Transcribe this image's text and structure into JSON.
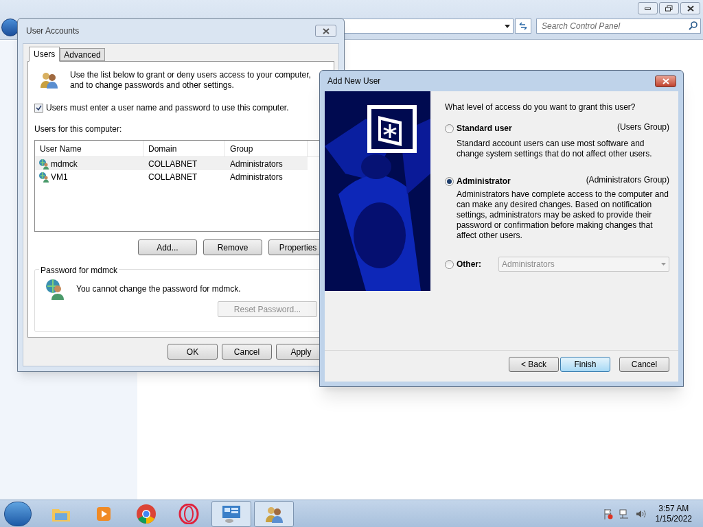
{
  "control_panel": {
    "search_placeholder": "Search Control Panel"
  },
  "user_accounts": {
    "title": "User Accounts",
    "tabs": [
      {
        "label": "Users",
        "selected": true
      },
      {
        "label": "Advanced",
        "selected": false
      }
    ],
    "intro": "Use the list below to grant or deny users access to your computer, and to change passwords and other settings.",
    "require_login": {
      "label": "Users must enter a user name and password to use this computer.",
      "checked": true
    },
    "list_label": "Users for this computer:",
    "columns": [
      "User Name",
      "Domain",
      "Group"
    ],
    "rows": [
      {
        "cells": [
          "mdmck",
          "COLLABNET",
          "Administrators"
        ],
        "selected": true
      },
      {
        "cells": [
          "VM1",
          "COLLABNET",
          "Administrators"
        ],
        "selected": false
      }
    ],
    "buttons": [
      "Add...",
      "Remove",
      "Properties"
    ],
    "password_group": {
      "title": "Password for mdmck",
      "message": "You cannot change the password for mdmck.",
      "button": {
        "label": "Reset Password...",
        "disabled": true
      }
    },
    "footer_buttons": [
      "OK",
      "Cancel",
      "Apply"
    ]
  },
  "add_user": {
    "title": "Add New User",
    "question": "What level of access do you want to grant this user?",
    "options": [
      {
        "kind": "described",
        "label": "Standard user",
        "group": "(Users Group)",
        "description": "Standard account users can use most software and change system settings that do not affect other users.",
        "selected": false
      },
      {
        "kind": "described",
        "label": "Administrator",
        "group": "(Administrators Group)",
        "description": "Administrators have complete access to the computer and can make any desired changes. Based on notification settings, administrators may be asked to provide their password or confirmation before making changes that affect other users.",
        "selected": true
      },
      {
        "kind": "dropdown",
        "label": "Other:",
        "value": "Administrators",
        "disabled": true,
        "selected": false
      }
    ],
    "footer_buttons": [
      {
        "label": "< Back",
        "default": false
      },
      {
        "label": "Finish",
        "default": true
      },
      {
        "label": "Cancel",
        "default": false
      }
    ]
  },
  "taskbar": {
    "apps": [
      {
        "open": false
      },
      {
        "open": false
      },
      {
        "open": false
      },
      {
        "open": false
      },
      {
        "open": true
      },
      {
        "open": true
      }
    ],
    "time": "3:57 AM",
    "date": "1/15/2022"
  }
}
